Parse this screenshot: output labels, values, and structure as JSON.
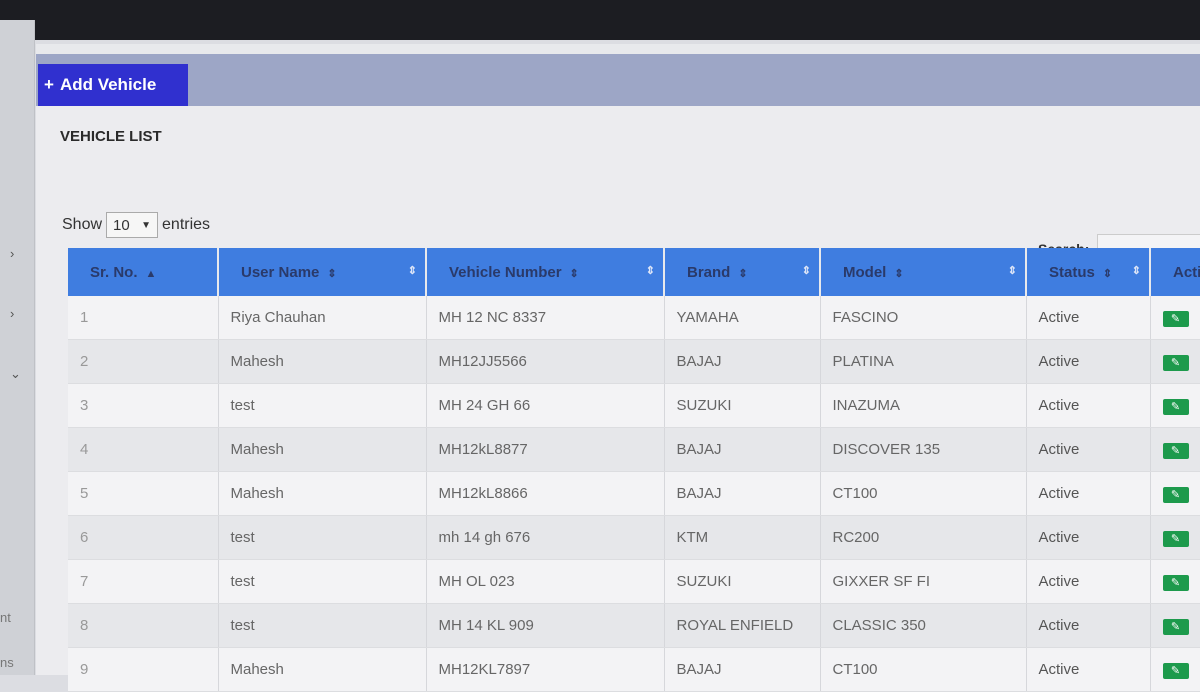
{
  "toolbar": {
    "add_vehicle_label": "Add Vehicle"
  },
  "page": {
    "title": "VEHICLE LIST"
  },
  "length_control": {
    "prefix": "Show",
    "value": "10",
    "suffix": "entries"
  },
  "search": {
    "label": "Search:"
  },
  "table": {
    "headers": [
      "Sr. No.",
      "User Name",
      "Vehicle Number",
      "Brand",
      "Model",
      "Status",
      "Acti"
    ],
    "rows": [
      [
        "1",
        "Riya Chauhan",
        "MH 12 NC 8337",
        "YAMAHA",
        "FASCINO",
        "Active"
      ],
      [
        "2",
        "Mahesh",
        "MH12JJ5566",
        "BAJAJ",
        "PLATINA",
        "Active"
      ],
      [
        "3",
        "test",
        "MH 24 GH 66",
        "SUZUKI",
        "INAZUMA",
        "Active"
      ],
      [
        "4",
        "Mahesh",
        "MH12kL8877",
        "BAJAJ",
        "DISCOVER 135",
        "Active"
      ],
      [
        "5",
        "Mahesh",
        "MH12kL8866",
        "BAJAJ",
        "CT100",
        "Active"
      ],
      [
        "6",
        "test",
        "mh 14 gh 676",
        "KTM",
        "RC200",
        "Active"
      ],
      [
        "7",
        "test",
        "MH OL 023",
        "SUZUKI",
        "GIXXER SF FI",
        "Active"
      ],
      [
        "8",
        "test",
        "MH 14 KL 909",
        "ROYAL ENFIELD",
        "CLASSIC 350",
        "Active"
      ],
      [
        "9",
        "Mahesh",
        "MH12KL7897",
        "BAJAJ",
        "CT100",
        "Active"
      ]
    ]
  },
  "sidebar": {
    "text_1": "nt",
    "text_2": "ns"
  },
  "colors": {
    "header": "#3f7de0",
    "add_button": "#3030cf",
    "edit": "#1d9a4c"
  }
}
